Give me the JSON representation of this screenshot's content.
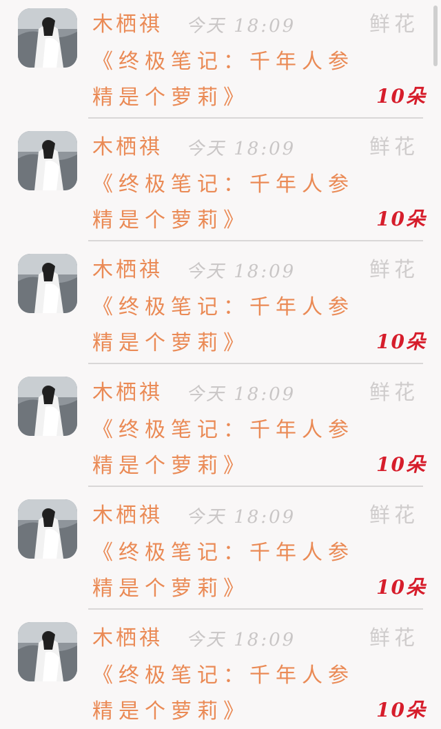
{
  "colors": {
    "background": "#f9f7f7",
    "author": "#ea8a55",
    "message": "#ea8a55",
    "time": "#c9c6c6",
    "gift_type": "#cfcccc",
    "count": "#d61d2b",
    "divider": "#d9d7d7"
  },
  "feed": {
    "items": [
      {
        "author": "木栖祺",
        "time": "今天 18:09",
        "message": "《终极笔记：千年人参精是个萝莉》",
        "gift_type": "鲜花",
        "count": "10朵",
        "avatar_icon": "avatar-image"
      },
      {
        "author": "木栖祺",
        "time": "今天 18:09",
        "message": "《终极笔记：千年人参精是个萝莉》",
        "gift_type": "鲜花",
        "count": "10朵",
        "avatar_icon": "avatar-image"
      },
      {
        "author": "木栖祺",
        "time": "今天 18:09",
        "message": "《终极笔记：千年人参精是个萝莉》",
        "gift_type": "鲜花",
        "count": "10朵",
        "avatar_icon": "avatar-image"
      },
      {
        "author": "木栖祺",
        "time": "今天 18:09",
        "message": "《终极笔记：千年人参精是个萝莉》",
        "gift_type": "鲜花",
        "count": "10朵",
        "avatar_icon": "avatar-image"
      },
      {
        "author": "木栖祺",
        "time": "今天 18:09",
        "message": "《终极笔记：千年人参精是个萝莉》",
        "gift_type": "鲜花",
        "count": "10朵",
        "avatar_icon": "avatar-image"
      },
      {
        "author": "木栖祺",
        "time": "今天 18:09",
        "message": "《终极笔记：千年人参精是个萝莉》",
        "gift_type": "鲜花",
        "count": "10朵",
        "avatar_icon": "avatar-image"
      }
    ]
  }
}
